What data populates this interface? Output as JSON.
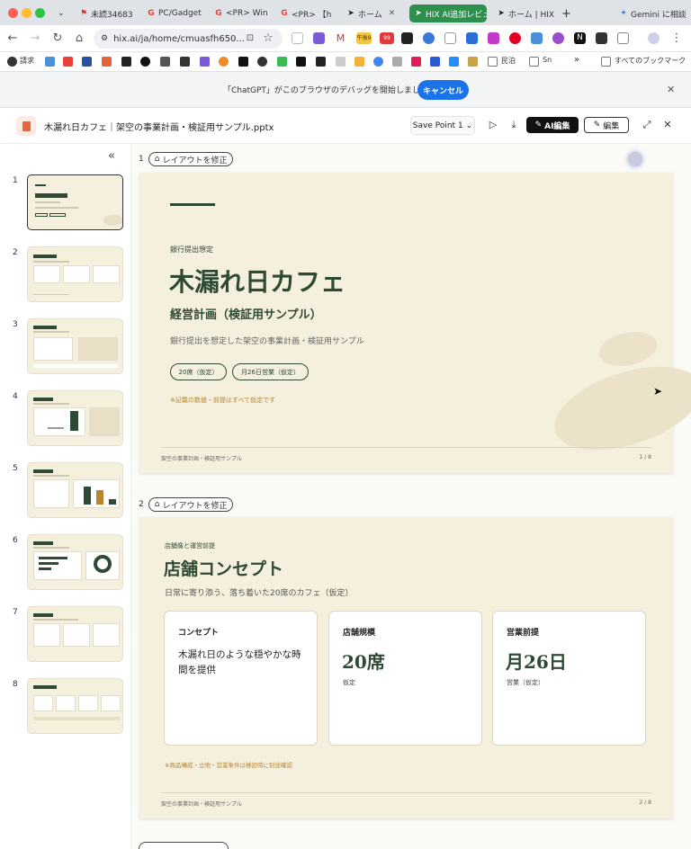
{
  "browser": {
    "tabs": [
      {
        "label": "未読34683"
      },
      {
        "label": "PC/Gadget"
      },
      {
        "label": "<PR> Win"
      },
      {
        "label": "<PR> 【h"
      },
      {
        "label": "ホーム"
      },
      {
        "label": "HIX AI追加レビュー"
      },
      {
        "label": "ホーム | HIX"
      }
    ],
    "gemini_label": "Gemini に相談",
    "url": "hix.ai/ja/home/cmuasfh650...",
    "bookmarks": [
      {
        "label": "請求"
      },
      {
        "label": "民泊"
      },
      {
        "label": "Sn"
      }
    ],
    "bookmarks_more": "»",
    "all_bookmarks": "すべてのブックマーク",
    "badge_count": "99",
    "calendar_badge": "午後9"
  },
  "debug_banner": {
    "message": "「ChatGPT」がこのブラウザのデバッグを開始しました",
    "cancel_label": "キャンセル"
  },
  "app_header": {
    "filename": "木漏れ日カフェ｜架空の事業計画・検証用サンプル.pptx",
    "save_point": "Save Point 1",
    "ai_edit_label": "AI編集",
    "edit_label": "編集"
  },
  "sidebar": {
    "thumbnails": [
      {
        "num": "1"
      },
      {
        "num": "2"
      },
      {
        "num": "3"
      },
      {
        "num": "4"
      },
      {
        "num": "5"
      },
      {
        "num": "6"
      },
      {
        "num": "7"
      },
      {
        "num": "8"
      }
    ]
  },
  "main": {
    "fix_layout_label": "レイアウトを修正",
    "slides": [
      {
        "num": "1",
        "kicker": "銀行提出想定",
        "title": "木漏れ日カフェ",
        "subtitle": "経営計画（検証用サンプル）",
        "description": "銀行提出を想定した架空の事業計画・検証用サンプル",
        "pills": [
          "20席（仮定）",
          "月26日営業（仮定）"
        ],
        "note": "※記載の数値・前提はすべて仮定です",
        "footer_left": "架空の事業計画・検証用サンプル",
        "footer_right": "1 / 8"
      },
      {
        "num": "2",
        "kicker": "店舗像と運営前提",
        "title": "店舗コンセプト",
        "description": "日常に寄り添う、落ち着いた20席のカフェ（仮定）",
        "cards": [
          {
            "title": "コンセプト",
            "body": "木漏れ日のような穏やかな時間を提供"
          },
          {
            "title": "店舗規模",
            "value": "20席",
            "sub": "仮定"
          },
          {
            "title": "営業前提",
            "value": "月26日",
            "sub": "営業（仮定）"
          }
        ],
        "note": "※商品構成・立地・営業条件は検証時に別途確認",
        "footer_left": "架空の事業計画・検証用サンプル",
        "footer_right": "2 / 8"
      }
    ]
  },
  "colors": {
    "slide_bg": "#f5efdd",
    "accent_green": "#2e4a35",
    "note_orange": "#b8862e",
    "debug_button": "#1a73e8"
  }
}
